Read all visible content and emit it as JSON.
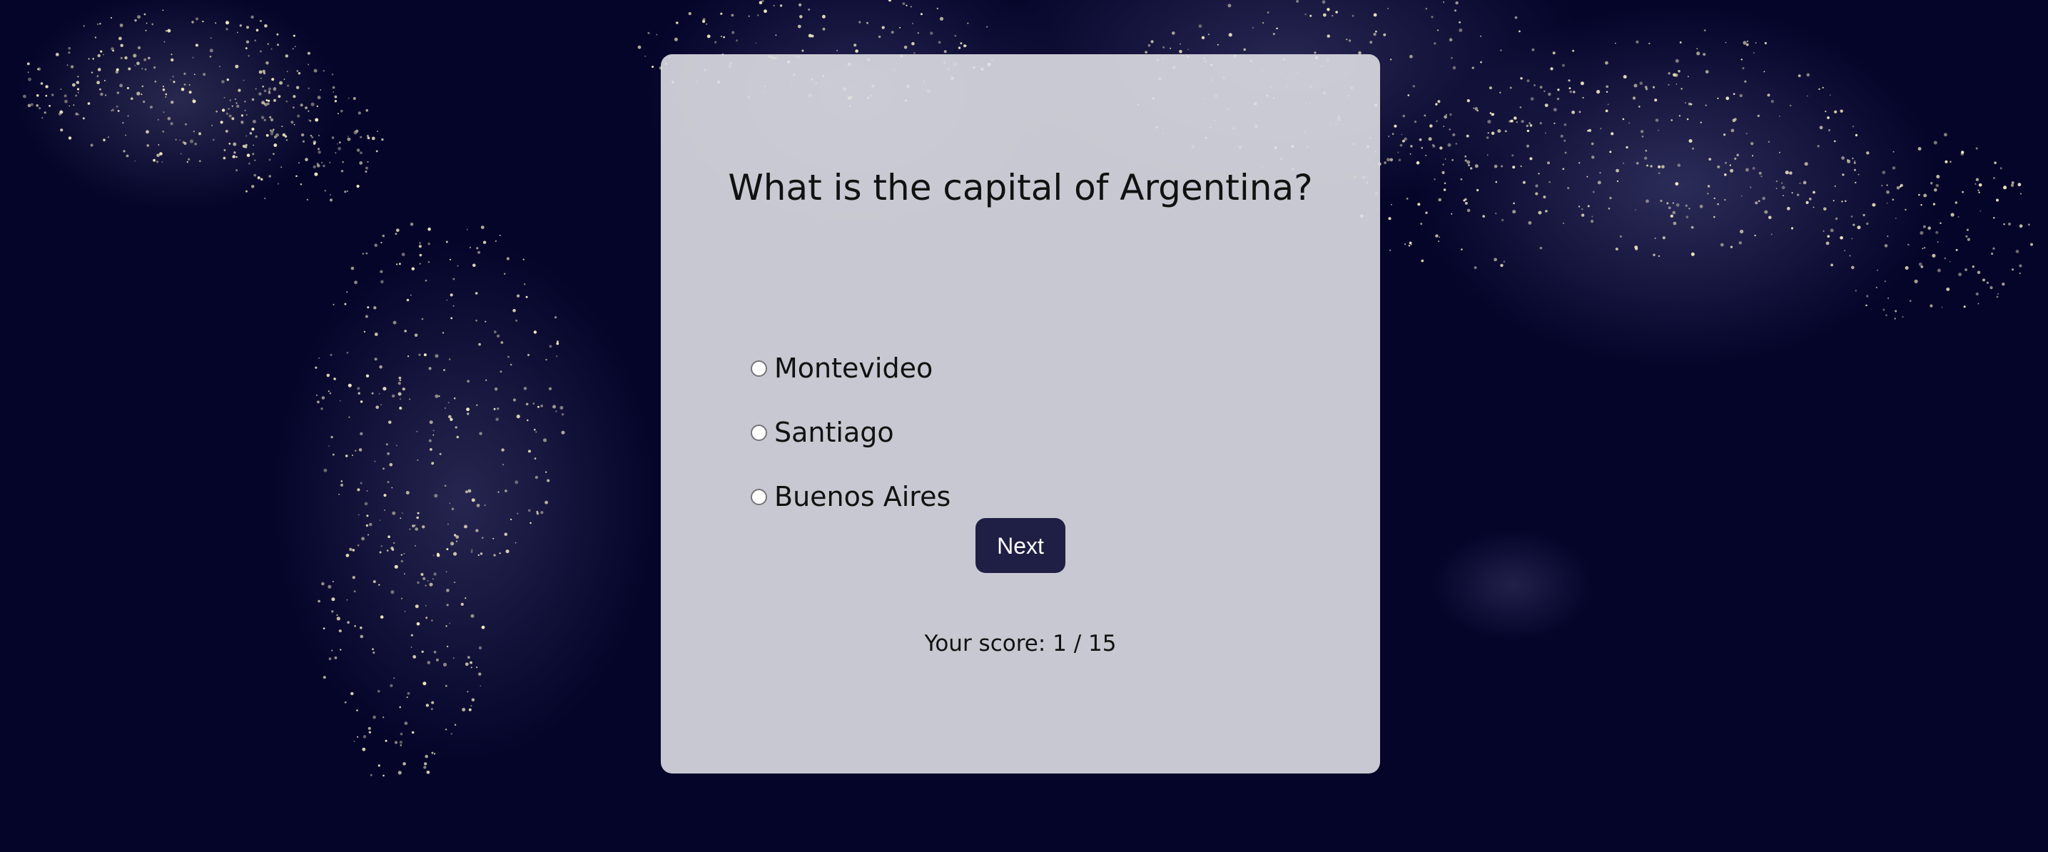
{
  "background": {
    "description_icon": "world-night-lights-map",
    "base_color": "#05052a",
    "light_color": "#fff6c8"
  },
  "quiz": {
    "question": "What is the capital of Argentina?",
    "options": [
      {
        "label": "Montevideo",
        "selected": false
      },
      {
        "label": "Santiago",
        "selected": false
      },
      {
        "label": "Buenos Aires",
        "selected": false
      }
    ],
    "next_label": "Next",
    "score_text": "Your score: 1 / 15"
  },
  "colors": {
    "card_bg": "#dedee4",
    "button_bg": "#1f1f45",
    "button_text": "#ffffff",
    "text": "#111111"
  }
}
